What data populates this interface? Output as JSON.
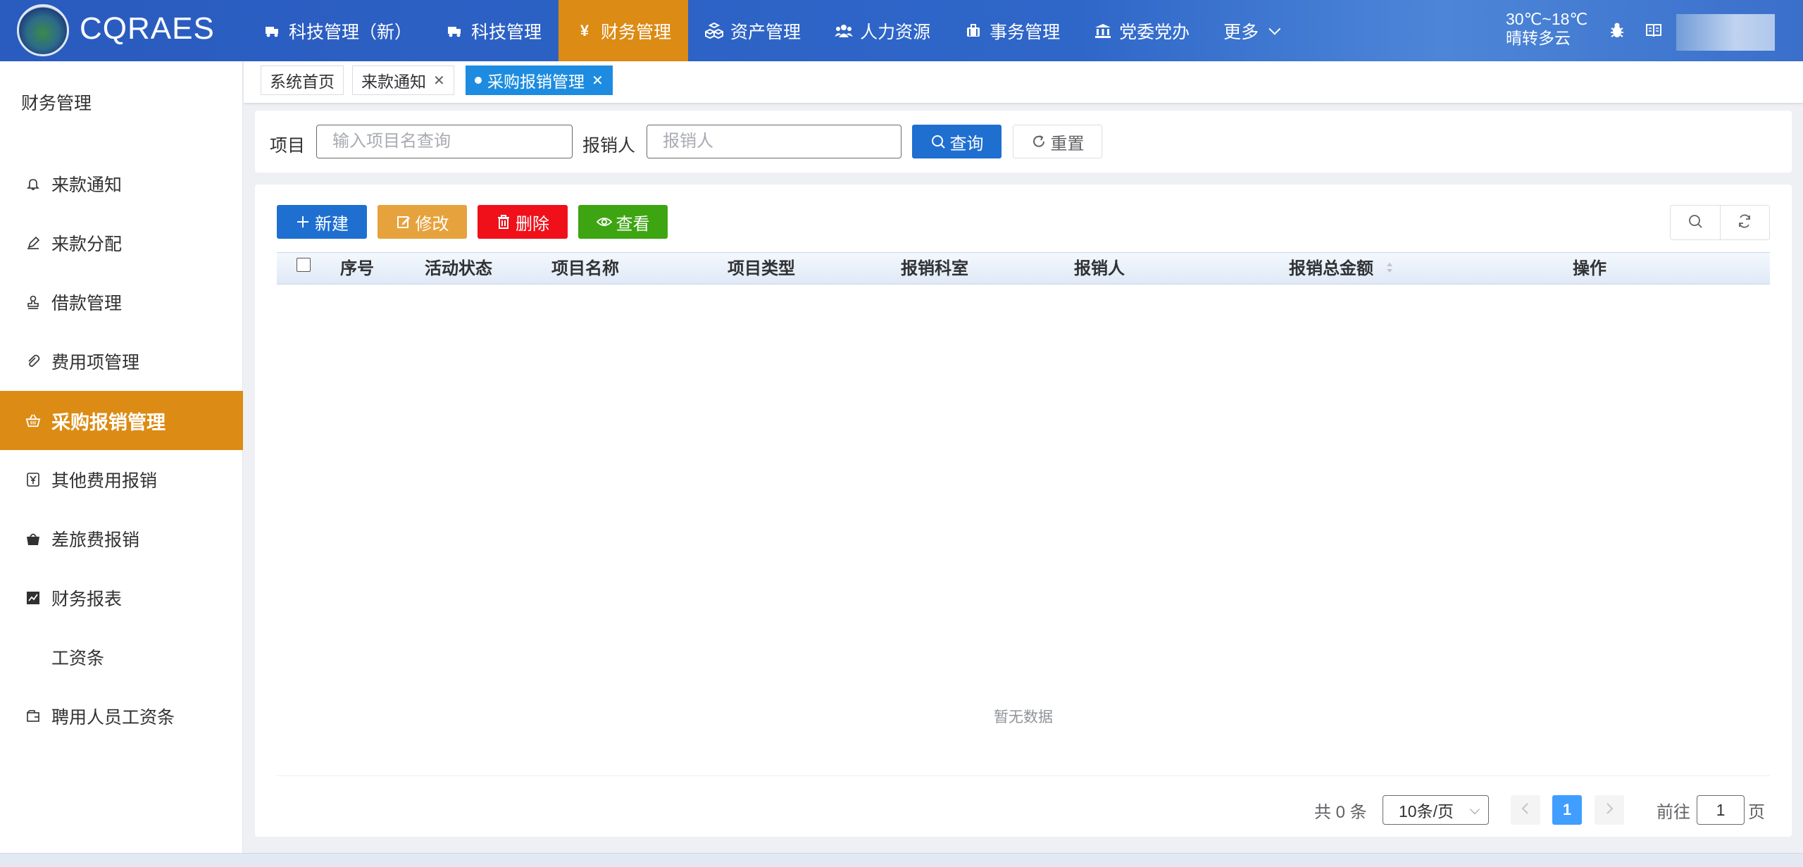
{
  "header": {
    "brand": "CQRAES",
    "nav": [
      {
        "label": "科技管理（新）",
        "icon": "truck-icon",
        "active": false
      },
      {
        "label": "科技管理",
        "icon": "truck-icon",
        "active": false
      },
      {
        "label": "财务管理",
        "icon": "yen-icon",
        "active": true
      },
      {
        "label": "资产管理",
        "icon": "cubes-icon",
        "active": false
      },
      {
        "label": "人力资源",
        "icon": "users-icon",
        "active": false
      },
      {
        "label": "事务管理",
        "icon": "briefcase-icon",
        "active": false
      },
      {
        "label": "党委党办",
        "icon": "bank-icon",
        "active": false
      },
      {
        "label": "更多",
        "icon": "",
        "active": false
      }
    ],
    "weather_temp": "30℃~18℃",
    "weather_desc": "晴转多云"
  },
  "sidebar": {
    "title": "财务管理",
    "items": [
      {
        "label": "来款通知",
        "icon": "bell-icon"
      },
      {
        "label": "来款分配",
        "icon": "pen-icon"
      },
      {
        "label": "借款管理",
        "icon": "stamp-icon"
      },
      {
        "label": "费用项管理",
        "icon": "paperclip-icon"
      },
      {
        "label": "采购报销管理",
        "icon": "basket-icon",
        "active": true
      },
      {
        "label": "其他费用报销",
        "icon": "yen-doc-icon"
      },
      {
        "label": "差旅费报销",
        "icon": "bag-icon"
      },
      {
        "label": "财务报表",
        "icon": "chart-icon"
      },
      {
        "label": "工资条",
        "icon": ""
      },
      {
        "label": "聘用人员工资条",
        "icon": "wallet-icon"
      }
    ]
  },
  "tabs": [
    {
      "label": "系统首页",
      "closable": false
    },
    {
      "label": "来款通知",
      "closable": true
    },
    {
      "label": "采购报销管理",
      "closable": true,
      "active": true
    }
  ],
  "search": {
    "project_label": "项目",
    "project_placeholder": "输入项目名查询",
    "applicant_label": "报销人",
    "applicant_placeholder": "报销人",
    "query_button": "查询",
    "reset_button": "重置"
  },
  "toolbar": {
    "add": "新建",
    "edit": "修改",
    "delete": "删除",
    "view": "查看"
  },
  "table": {
    "columns": [
      "序号",
      "活动状态",
      "项目名称",
      "项目类型",
      "报销科室",
      "报销人",
      "报销总金额",
      "操作"
    ],
    "rows": [],
    "empty_text": "暂无数据"
  },
  "pagination": {
    "total_text": "共 0 条",
    "page_size": "10条/页",
    "current_page": "1",
    "goto_prefix": "前往",
    "goto_value": "1",
    "goto_suffix": "页"
  },
  "colors": {
    "header_blue": "#2f67c9",
    "accent_orange": "#dc8b14",
    "primary": "#1f6fd1",
    "danger": "#f0101a",
    "success": "#3da511",
    "warning": "#e6a23c",
    "tab_active": "#1d8ce0"
  }
}
